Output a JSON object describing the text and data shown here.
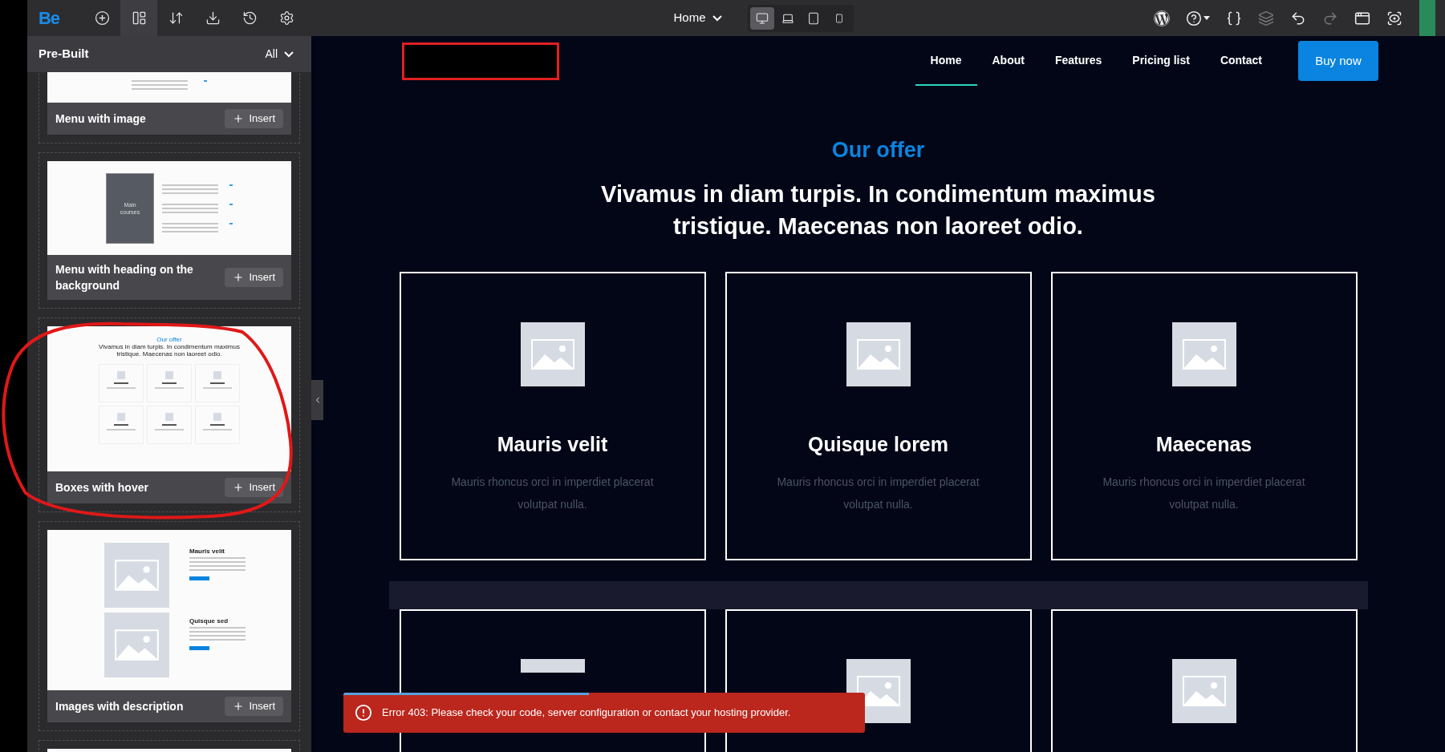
{
  "toolbar": {
    "logo": "Be",
    "tools": [
      {
        "kind": "add",
        "selected": false
      },
      {
        "kind": "prebuilt",
        "selected": true
      },
      {
        "kind": "sort",
        "selected": false
      },
      {
        "kind": "export",
        "selected": false
      },
      {
        "kind": "history",
        "selected": false
      },
      {
        "kind": "settings",
        "selected": false
      }
    ]
  },
  "page_selector": {
    "label": "Home"
  },
  "devices": [
    {
      "kind": "desktop",
      "selected": true
    },
    {
      "kind": "laptop",
      "selected": false
    },
    {
      "kind": "tablet",
      "selected": false
    },
    {
      "kind": "mobile",
      "selected": false
    }
  ],
  "actions": [
    {
      "kind": "wordpress",
      "disabled": false
    },
    {
      "kind": "help",
      "disabled": false
    },
    {
      "kind": "css",
      "disabled": false
    },
    {
      "kind": "layers",
      "disabled": true
    },
    {
      "kind": "undo",
      "disabled": false
    },
    {
      "kind": "redo",
      "disabled": true
    },
    {
      "kind": "window",
      "disabled": false
    },
    {
      "kind": "preview",
      "disabled": false
    }
  ],
  "sidebar": {
    "title": "Pre-Built",
    "filter": "All",
    "items": [
      {
        "kind": "menu-image",
        "name": "Menu with image",
        "button": "Insert"
      },
      {
        "kind": "menu-heading",
        "name": "Menu with heading on the background",
        "button": "Insert",
        "thumb_texts": [
          "Main courses"
        ]
      },
      {
        "kind": "boxes",
        "name": "Boxes with hover",
        "button": "Insert",
        "thumb_texts": [
          "Our offer",
          "Vivamus in diam turpis. In condimentum maximus tristique. Maecenas non laoreet odio."
        ]
      },
      {
        "kind": "images-desc",
        "name": "Images with description",
        "button": "Insert",
        "thumb_texts": [
          "Mauris velit",
          "Quisque sed"
        ]
      },
      {
        "kind": "cut"
      }
    ]
  },
  "site": {
    "nav": [
      {
        "label": "Home",
        "selected": true
      },
      {
        "label": "About",
        "selected": false
      },
      {
        "label": "Features",
        "selected": false
      },
      {
        "label": "Pricing list",
        "selected": false
      },
      {
        "label": "Contact",
        "selected": false
      }
    ],
    "buy_button": "Buy now",
    "eyebrow": "Our offer",
    "heading": "Vivamus in diam turpis. In condimentum maximus tristique. Maecenas non laoreet odio.",
    "boxes": [
      {
        "title": "Mauris velit",
        "text": "Mauris rhoncus orci in imperdiet placerat volutpat nulla."
      },
      {
        "title": "Quisque lorem",
        "text": "Mauris rhoncus orci in imperdiet placerat volutpat nulla."
      },
      {
        "title": "Maecenas",
        "text": "Mauris rhoncus orci in imperdiet placerat volutpat nulla."
      }
    ]
  },
  "error": {
    "message": "Error 403: Please check your code, server configuration or contact your hosting provider.",
    "level": 0.47
  }
}
